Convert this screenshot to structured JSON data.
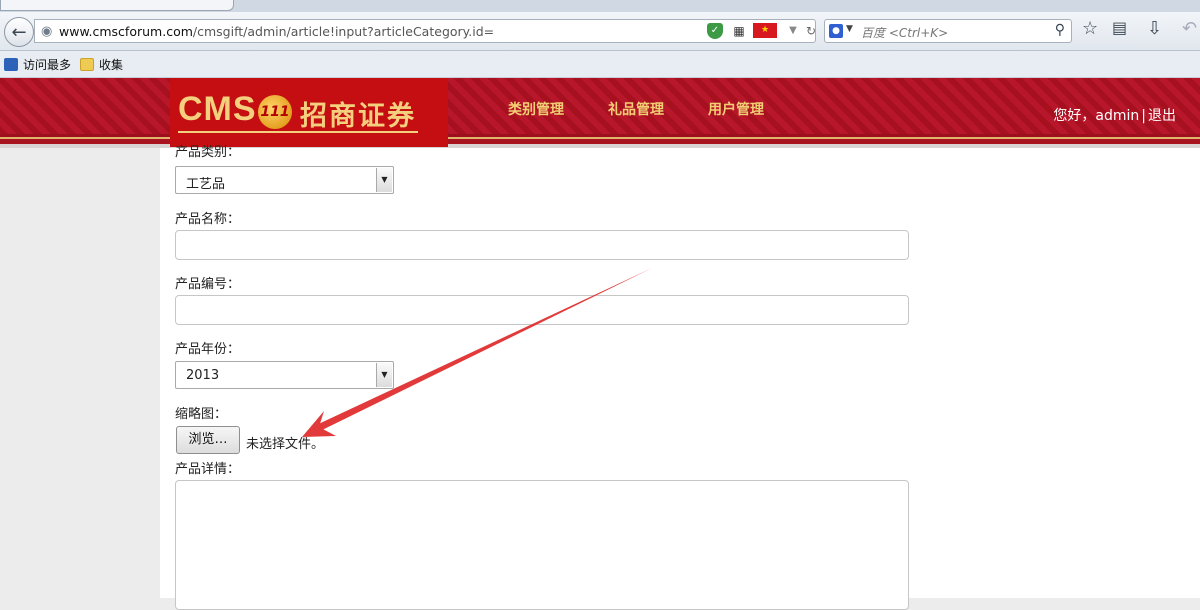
{
  "browser": {
    "url_host": "www.cmscforum.com",
    "url_path": "/cmsgift/admin/article!input?articleCategory.id=",
    "search_placeholder": "百度 <Ctrl+K>",
    "bookmarks": [
      "访问最多",
      "收集"
    ]
  },
  "header": {
    "logo_text": "CMS",
    "logo_badge": "111",
    "logo_cn": "招商证券",
    "nav": [
      "类别管理",
      "礼品管理",
      "用户管理"
    ],
    "greeting": "您好，",
    "username": "admin",
    "separator": "|",
    "logout": "退出"
  },
  "form": {
    "category_label": "产品类别：",
    "category_value": "工艺品",
    "name_label": "产品名称：",
    "name_value": "",
    "code_label": "产品编号：",
    "code_value": "",
    "year_label": "产品年份：",
    "year_value": "2013",
    "thumb_label": "缩略图：",
    "browse_button": "浏览…",
    "file_status": "未选择文件。",
    "detail_label": "产品详情："
  },
  "colors": {
    "header_red": "#b8162a",
    "logo_red": "#c50e12",
    "nav_gold": "#f3cf73",
    "annotation_arrow": "#e23a3a"
  }
}
